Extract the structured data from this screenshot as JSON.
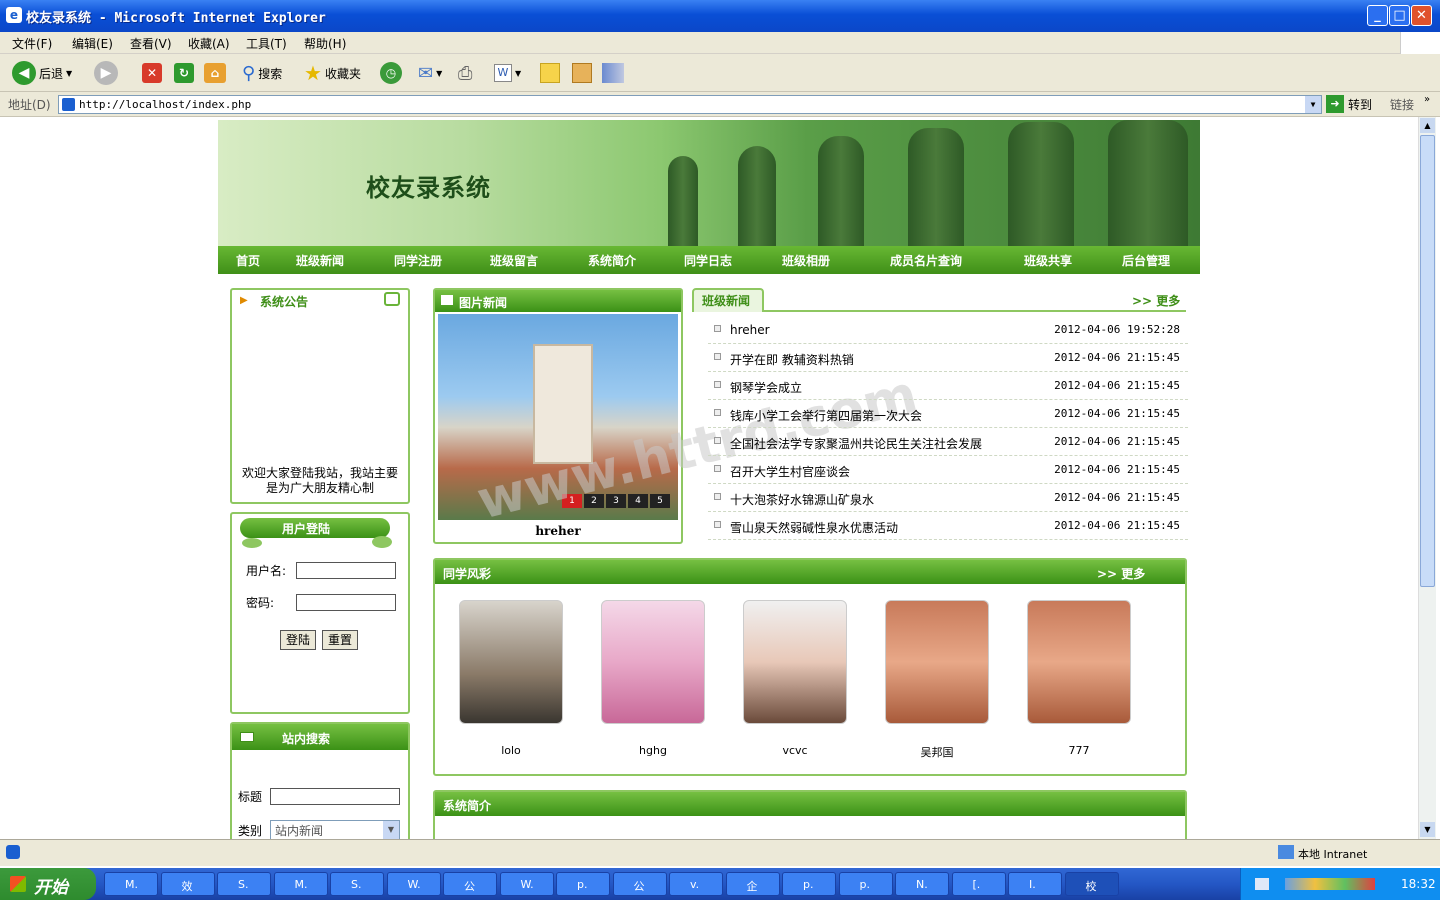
{
  "window": {
    "title": "校友录系统 - Microsoft Internet Explorer",
    "min": "_",
    "max": "□",
    "close": "✕"
  },
  "menu": [
    "文件(F)",
    "编辑(E)",
    "查看(V)",
    "收藏(A)",
    "工具(T)",
    "帮助(H)"
  ],
  "toolbar": {
    "back": "后退",
    "search": "搜索",
    "favorites": "收藏夹"
  },
  "address": {
    "label": "地址(D)",
    "url": "http://localhost/index.php",
    "go": "转到",
    "links": "链接"
  },
  "site": {
    "title": "校友录系统",
    "nav": [
      "首页",
      "班级新闻",
      "同学注册",
      "班级留言",
      "系统简介",
      "同学日志",
      "班级相册",
      "成员名片查询",
      "班级共享",
      "后台管理"
    ],
    "notice": {
      "title": "系统公告",
      "text": "欢迎大家登陆我站，我站主要是为广大朋友精心制"
    },
    "login": {
      "title": "用户登陆",
      "user_label": "用户名:",
      "pass_label": "密码:",
      "login_btn": "登陆",
      "reset_btn": "重置"
    },
    "search": {
      "title": "站内搜索",
      "title_label": "标题",
      "type_label": "类别",
      "type_value": "站内新闻"
    },
    "photo_news": {
      "title": "图片新闻",
      "caption": "hreher",
      "pages": [
        "1",
        "2",
        "3",
        "4",
        "5"
      ]
    },
    "news": {
      "title": "班级新闻",
      "more": "更多",
      "items": [
        {
          "title": "hreher",
          "date": "2012-04-06 19:52:28"
        },
        {
          "title": "开学在即 教辅资料热销",
          "date": "2012-04-06 21:15:45"
        },
        {
          "title": "钢琴学会成立",
          "date": "2012-04-06 21:15:45"
        },
        {
          "title": "钱库小学工会举行第四届第一次大会",
          "date": "2012-04-06 21:15:45"
        },
        {
          "title": "全国社会法学专家聚温州共论民生关注社会发展",
          "date": "2012-04-06 21:15:45"
        },
        {
          "title": "召开大学生村官座谈会",
          "date": "2012-04-06 21:15:45"
        },
        {
          "title": "十大泡茶好水锦源山矿泉水",
          "date": "2012-04-06 21:15:45"
        },
        {
          "title": "雪山泉天然弱碱性泉水优惠活动",
          "date": "2012-04-06 21:15:45"
        }
      ]
    },
    "classmates": {
      "title": "同学风彩",
      "more": "更多",
      "people": [
        "lolo",
        "hghg",
        "vcvc",
        "吴邦国",
        "777"
      ]
    },
    "intro": {
      "title": "系统简介"
    },
    "watermark": "www.httrd.com"
  },
  "status": {
    "zone": "本地 Intranet"
  },
  "taskbar": {
    "start": "开始",
    "tasks": [
      "M.",
      "效",
      "S.",
      "M.",
      "S.",
      "W.",
      "公",
      "W.",
      "p.",
      "公",
      "v.",
      "企",
      "p.",
      "p.",
      "N.",
      "[.",
      "I.",
      "校"
    ],
    "clock": "18:32"
  },
  "colors": {
    "brand_green": "#3f8f18",
    "accent_green": "#8ec761",
    "title_blue": "#0a4fd6"
  }
}
